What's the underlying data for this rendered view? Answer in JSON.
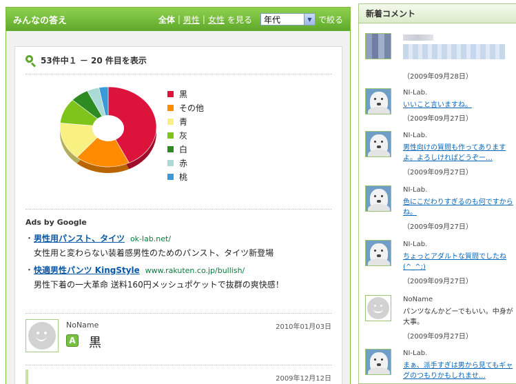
{
  "main": {
    "title": "みんなの答え",
    "filters": [
      "全体",
      "男性",
      "女性"
    ],
    "filter_suffix": "を見る",
    "age_select": "年代",
    "narrow_label": "で絞る",
    "count_text": "53件中１ － 20 件目を表示"
  },
  "chart_data": {
    "type": "pie",
    "categories": [
      "黒",
      "その他",
      "青",
      "灰",
      "白",
      "赤",
      "桃"
    ],
    "values": [
      42,
      18,
      15,
      10,
      6,
      4,
      3
    ],
    "colors": [
      "#dc143c",
      "#ff8c00",
      "#f8f080",
      "#7ec41a",
      "#2e8b22",
      "#aadad6",
      "#3a9ad9"
    ],
    "title": "",
    "legend": "right"
  },
  "ads": {
    "title": "Ads by Google",
    "items": [
      {
        "bullet": "・",
        "link": "男性用パンスト、タイツ",
        "url": "ok-lab.net/",
        "desc": "女性用と変わらない装着感男性のためのパンスト、タイツ新登場"
      },
      {
        "bullet": "・",
        "link": "快適男性パンツ KingStyle",
        "url": "www.rakuten.co.jp/bullish/",
        "desc": "男性下着の一大革命 送料160円メッシュポケットで抜群の爽快感！"
      }
    ]
  },
  "answer": {
    "name": "NoName",
    "date": "2010年01月03日",
    "badge": "A",
    "text": "黒"
  },
  "answer2": {
    "date": "2009年12月12日"
  },
  "sidebar": {
    "title": "新着コメント",
    "comments": [
      {
        "avatar": "pixelated",
        "name": "",
        "text": "",
        "date": "（2009年09月28日）",
        "link": true
      },
      {
        "avatar": "dog",
        "name": "NI-Lab.",
        "text": "いいこと言いますね。",
        "date": "（2009年09月27日）",
        "link": true
      },
      {
        "avatar": "dog",
        "name": "NI-Lab.",
        "text": "男性向けの質問も作ってありますよ。よろしければどうぞー…",
        "date": "（2009年09月27日）",
        "link": true
      },
      {
        "avatar": "dog",
        "name": "NI-Lab.",
        "text": "色にこだわりすぎるのも何ですからね。",
        "date": "（2009年09月27日）",
        "link": true
      },
      {
        "avatar": "dog",
        "name": "NI-Lab.",
        "text": "ちょっとアダルトな質問でしたね(^_^;)",
        "date": "（2009年09月27日）",
        "link": true
      },
      {
        "avatar": "gray",
        "name": "NoName",
        "text": "パンツなんかどーでもいい。中身が大事。",
        "date": "（2009年09月27日）",
        "link": false
      },
      {
        "avatar": "dog",
        "name": "NI-Lab.",
        "text": "まぁ、派手すぎは男から見てもギャグのつもりかもしれませ…",
        "date": "",
        "link": true
      }
    ]
  }
}
